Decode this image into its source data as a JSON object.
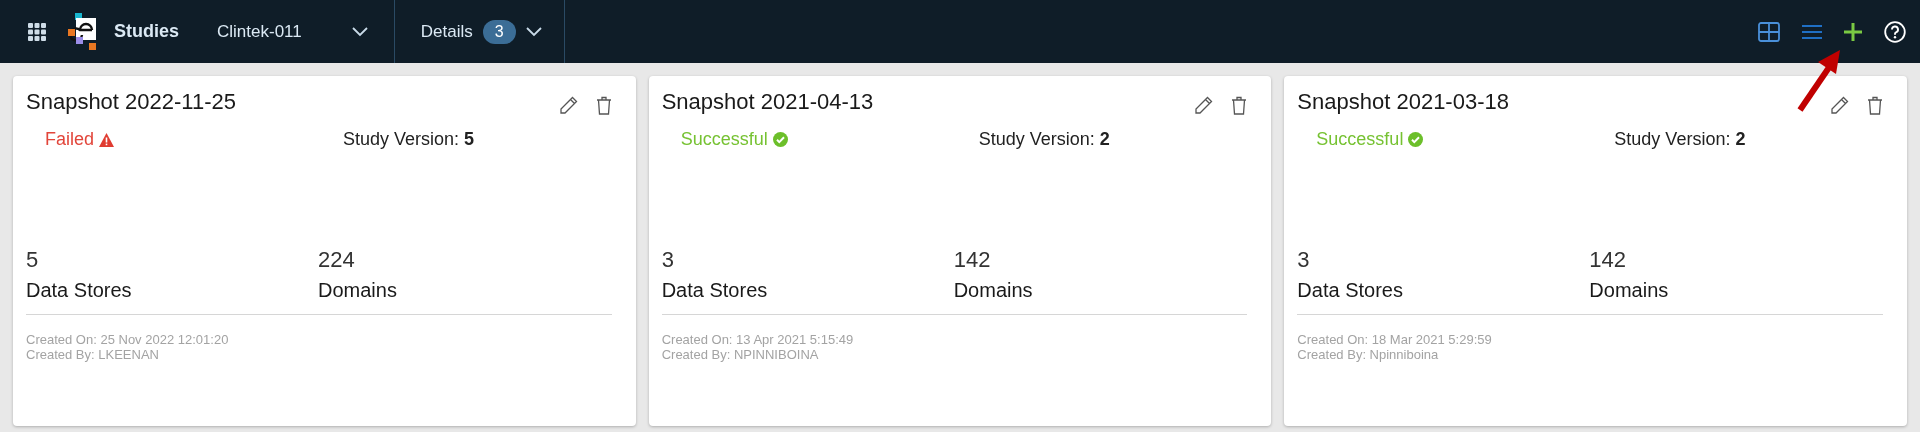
{
  "header": {
    "app_title": "Studies",
    "study": "Clintek-011",
    "details": {
      "label": "Details",
      "count": "3"
    }
  },
  "snapshots": [
    {
      "title": "Snapshot 2022-11-25",
      "status": {
        "kind": "failed",
        "label": "Failed"
      },
      "version": "Study Version: **5**",
      "stats": [
        {
          "value": "5",
          "label": "Data Stores"
        },
        {
          "value": "224",
          "label": "Domains"
        }
      ],
      "created_on": "Created On: 25 Nov 2022 12:01:20",
      "created_by": "Created By: LKEENAN"
    },
    {
      "title": "Snapshot 2021-04-13",
      "status": {
        "kind": "successful",
        "label": "Successful"
      },
      "version": "Study Version: **2**",
      "stats": [
        {
          "value": "3",
          "label": "Data Stores"
        },
        {
          "value": "142",
          "label": "Domains"
        }
      ],
      "created_on": "Created On: 13 Apr 2021 5:15:49",
      "created_by": "Created By: NPINNIBOINA"
    },
    {
      "title": "Snapshot 2021-03-18",
      "status": {
        "kind": "successful",
        "label": "Successful"
      },
      "version": "Study Version: **2**",
      "stats": [
        {
          "value": "3",
          "label": "Data Stores"
        },
        {
          "value": "142",
          "label": "Domains"
        }
      ],
      "created_on": "Created On: 18 Mar 2021 5:29:59",
      "created_by": "Created By: Npinniboina"
    }
  ]
}
